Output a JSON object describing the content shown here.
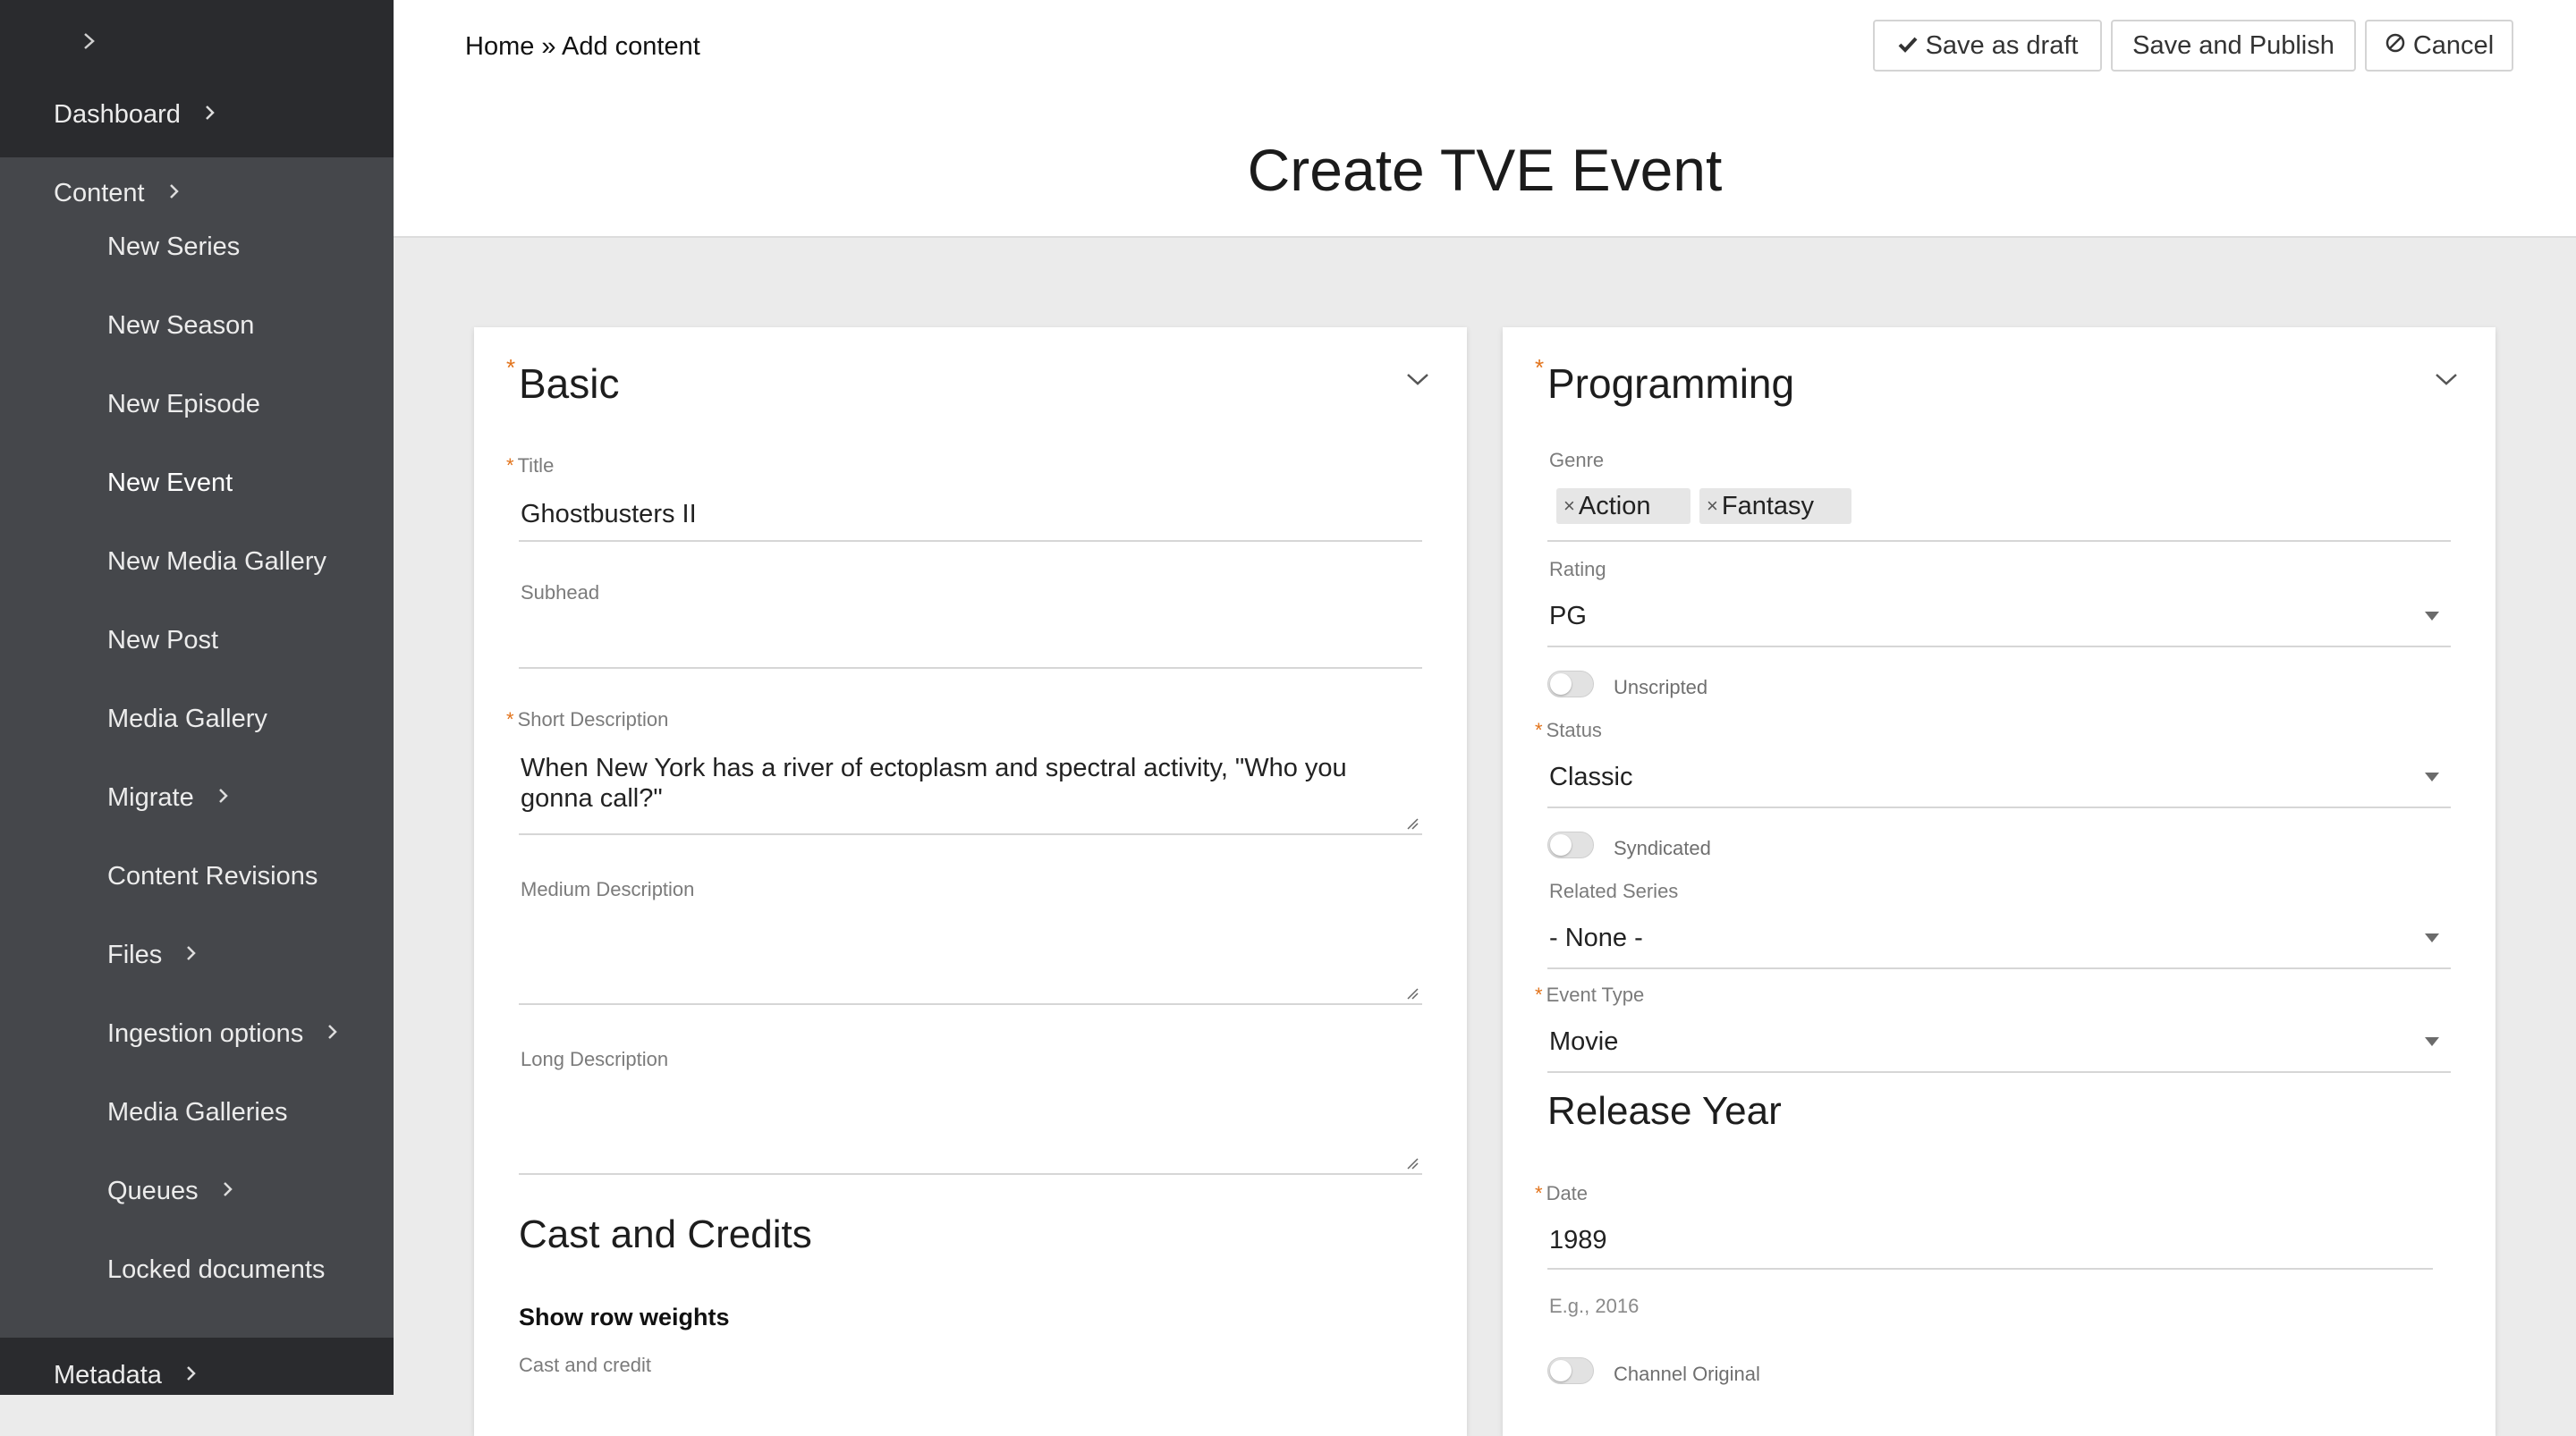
{
  "sidebar": {
    "toggle_icon": "chevron-right-icon",
    "items": [
      {
        "label": "Dashboard",
        "has_children": true
      },
      {
        "label": "Content",
        "has_children": true
      },
      {
        "label": "New Series"
      },
      {
        "label": "New Season"
      },
      {
        "label": "New Episode"
      },
      {
        "label": "New Event",
        "active": true
      },
      {
        "label": "New Media Gallery"
      },
      {
        "label": "New Post"
      },
      {
        "label": "Media Gallery"
      },
      {
        "label": "Migrate",
        "has_children": true
      },
      {
        "label": "Content Revisions"
      },
      {
        "label": "Files",
        "has_children": true
      },
      {
        "label": "Ingestion options",
        "has_children": true
      },
      {
        "label": "Media Galleries"
      },
      {
        "label": "Queues",
        "has_children": true
      },
      {
        "label": "Locked documents"
      },
      {
        "label": "Metadata",
        "has_children": true
      }
    ]
  },
  "header": {
    "breadcrumb": "Home » Add content",
    "title": "Create TVE Event",
    "buttons": {
      "save_draft": "Save as draft",
      "save_publish": "Save and Publish",
      "cancel": "Cancel"
    }
  },
  "basic": {
    "title": "Basic",
    "title_label": "Title",
    "title_value": "Ghostbusters II",
    "subhead_label": "Subhead",
    "subhead_value": "",
    "short_desc_label": "Short Description",
    "short_desc_value": "When New York has a river of ectoplasm and spectral activity, \"Who you gonna call?\"",
    "medium_desc_label": "Medium Description",
    "long_desc_label": "Long Description",
    "cast_heading": "Cast and Credits",
    "row_weights": "Show row weights",
    "cast_label": "Cast and credit"
  },
  "programming": {
    "title": "Programming",
    "genre_label": "Genre",
    "genres": [
      "Action",
      "Fantasy"
    ],
    "rating_label": "Rating",
    "rating_value": "PG",
    "unscripted_label": "Unscripted",
    "status_label": "Status",
    "status_value": "Classic",
    "syndicated_label": "Syndicated",
    "related_series_label": "Related Series",
    "related_series_value": "- None -",
    "event_type_label": "Event Type",
    "event_type_value": "Movie",
    "release_year_heading": "Release Year",
    "date_label": "Date",
    "date_value": "1989",
    "date_hint": "E.g., 2016",
    "channel_original_label": "Channel Original"
  },
  "colors": {
    "sidebar_bg": "#45474b",
    "sidebar_dark": "#2a2b2e",
    "required_marker": "#e2731b",
    "page_bg": "#ebebeb"
  }
}
